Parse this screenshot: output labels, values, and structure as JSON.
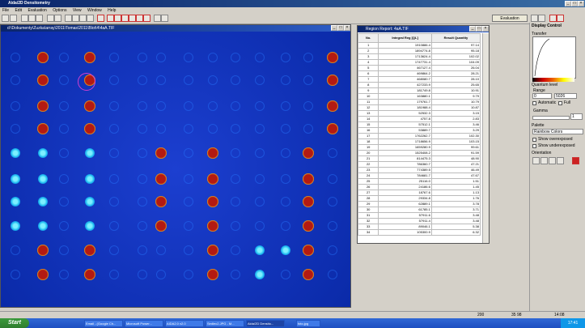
{
  "app": {
    "title": "Aida/2D Densitometry",
    "menu": [
      "File",
      "Edit",
      "Evaluation",
      "Options",
      "View",
      "Window",
      "Help"
    ],
    "evaluation_button": "Evaluation"
  },
  "image_window": {
    "title": "d:\\Dokumenty\\Zuzka\\array\\2011\\Tomas\\2011\\Blot\\4\\4aA.TIF"
  },
  "report": {
    "title": "Region Report: 4aA.TIF",
    "columns": [
      "No.",
      "Integral Reg [QL]",
      "Result Quantity"
    ],
    "rows": [
      [
        "1",
        "1910886.4",
        "97.14"
      ],
      [
        "2",
        "1894774.8",
        "95.18"
      ],
      [
        "3",
        "1713624.4",
        "102.02"
      ],
      [
        "4",
        "1747731.4",
        "104.09"
      ],
      [
        "5",
        "467127.4",
        "26.04"
      ],
      [
        "6",
        "469864.2",
        "28.21"
      ],
      [
        "7",
        "468080.7",
        "28.10"
      ],
      [
        "8",
        "427233.9",
        "25.65"
      ],
      [
        "9",
        "181749.8",
        "10.91"
      ],
      [
        "10",
        "163880.1",
        "9.79"
      ],
      [
        "11",
        "179761.7",
        "10.79"
      ],
      [
        "12",
        "181988.4",
        "10.87"
      ],
      [
        "13",
        "52532.3",
        "3.15"
      ],
      [
        "14",
        "4757.8",
        "2.83"
      ],
      [
        "15",
        "57512.1",
        "3.46"
      ],
      [
        "16",
        "53889.7",
        "3.29"
      ],
      [
        "17",
        "1762262.7",
        "102.30"
      ],
      [
        "18",
        "1718656.9",
        "103.15"
      ],
      [
        "19",
        "1659280.9",
        "99.61"
      ],
      [
        "20",
        "1525408.2",
        "91.59"
      ],
      [
        "21",
        "814475.3",
        "48.90"
      ],
      [
        "22",
        "786360.7",
        "47.21"
      ],
      [
        "23",
        "774389.5",
        "46.49"
      ],
      [
        "24",
        "784681.7",
        "47.67"
      ],
      [
        "25",
        "25116.0",
        "1.51"
      ],
      [
        "26",
        "24186.6",
        "1.45"
      ],
      [
        "27",
        "18767.6",
        "1.13"
      ],
      [
        "28",
        "29334.8",
        "1.76"
      ],
      [
        "29",
        "62889.1",
        "3.78"
      ],
      [
        "30",
        "61785.1",
        "3.71"
      ],
      [
        "31",
        "57911.6",
        "3.48"
      ],
      [
        "32",
        "57911.4",
        "3.48"
      ],
      [
        "33",
        "89046.1",
        "5.38"
      ],
      [
        "34",
        "105300.9",
        "6.32"
      ]
    ]
  },
  "right_panel": {
    "title": "Display Control",
    "transfer_label": "Transfer",
    "quantum_label": "Quantum level",
    "range_label": "Range",
    "range_min": "0",
    "range_max": "5026",
    "automatic_label": "Automatic",
    "full_label": "Full",
    "gamma_label": "Gamma",
    "gamma_value": "1",
    "palette_label": "Palette",
    "palette_value": "Rainbow Colors",
    "show_overexposed": "Show overexposed",
    "show_underexposed": "Show underexposed",
    "orientation_label": "Orientation"
  },
  "status": {
    "zoom": "200",
    "coords": "35 98",
    "time": "14:08"
  },
  "taskbar": {
    "start": "Start",
    "tasks": [
      "Email - (Google Ch...",
      "Microsoft Power...",
      "AIDA2.0 v2.0",
      "Sedlec2.JPG - M...",
      "Aida/2D Densito...",
      "foto.jpg"
    ],
    "clock": "17:41"
  },
  "colors": {
    "title_blue": "#0a246a",
    "blot_bg": "#0a2aa8",
    "spot_red": "#c0201a",
    "spot_cyan": "#2fd9f0"
  }
}
